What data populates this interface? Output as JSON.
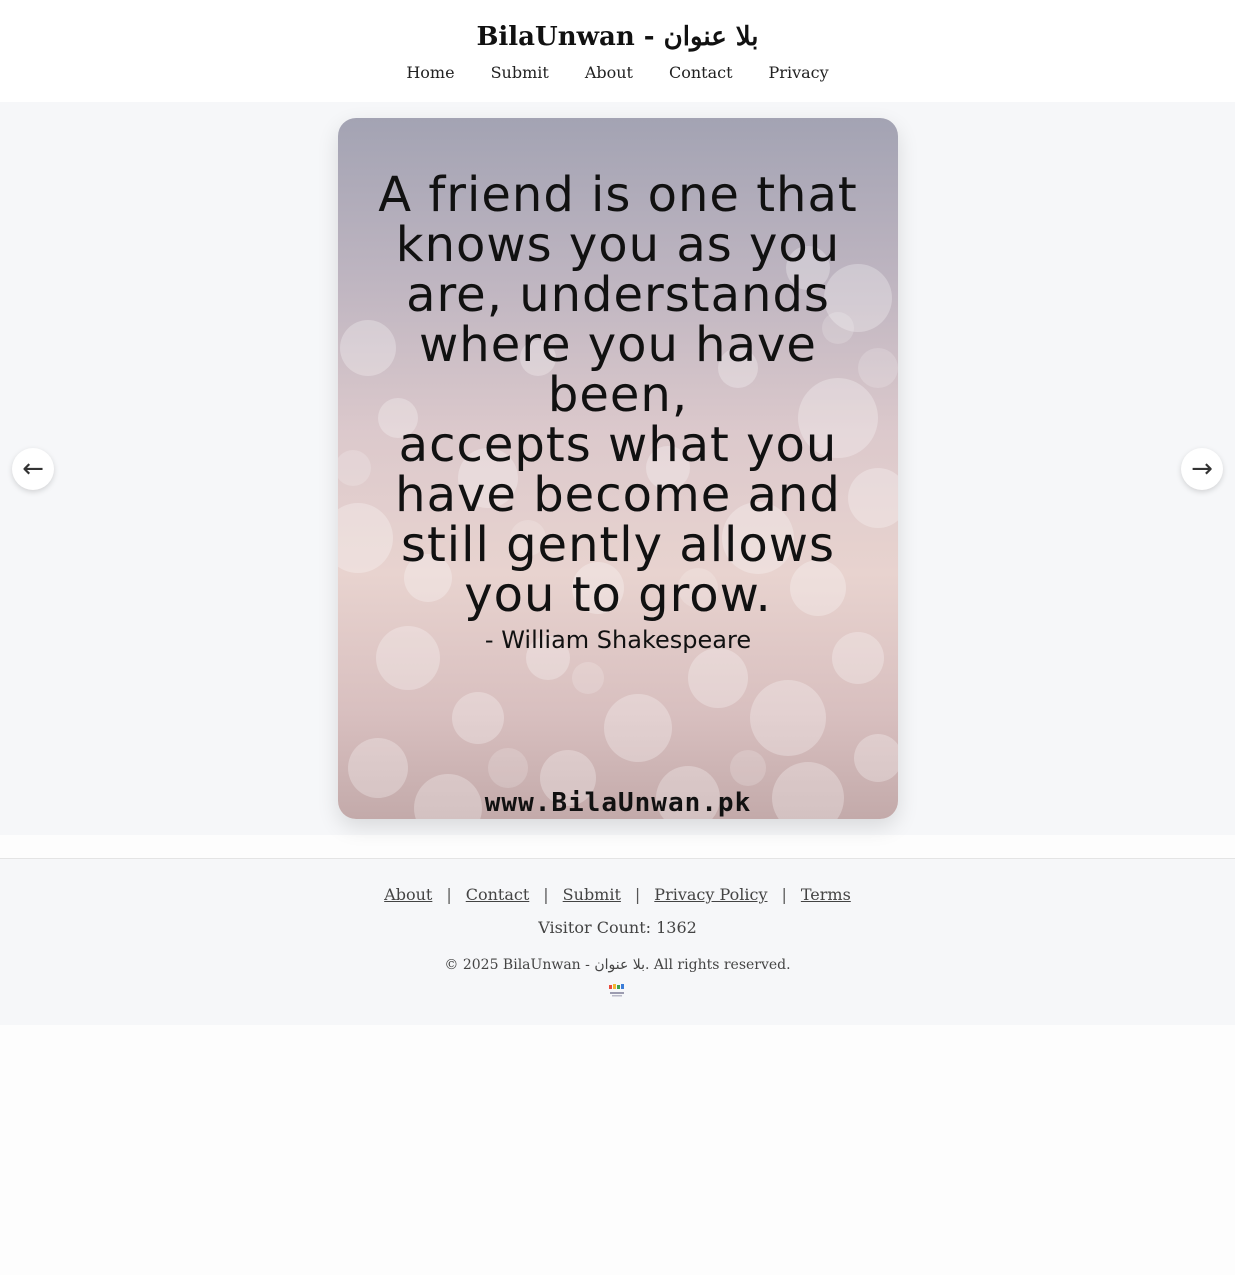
{
  "header": {
    "site_title": "BilaUnwan - بلا عنوان",
    "nav": [
      {
        "label": "Home"
      },
      {
        "label": "Submit"
      },
      {
        "label": "About"
      },
      {
        "label": "Contact"
      },
      {
        "label": "Privacy"
      }
    ]
  },
  "slide": {
    "quote": "A friend is one that\nknows you as you\nare, understands\nwhere you have been,\naccepts what you\nhave become and\nstill gently allows\nyou to grow.",
    "author": "- William Shakespeare",
    "watermark_url": "www.BilaUnwan.pk",
    "prev_icon": "←",
    "next_icon": "→"
  },
  "footer": {
    "links": [
      {
        "label": "About"
      },
      {
        "label": "Contact"
      },
      {
        "label": "Submit"
      },
      {
        "label": "Privacy Policy"
      },
      {
        "label": "Terms"
      }
    ],
    "separator": "|",
    "visitor_count": "Visitor Count: 1362",
    "copyright": "© 2025 BilaUnwan - بلا عنوان. All rights reserved."
  },
  "colors": {
    "background": "#fdfdfd",
    "stage_background": "#f6f7f9",
    "footer_background": "#f6f7f9",
    "text": "#222222"
  }
}
